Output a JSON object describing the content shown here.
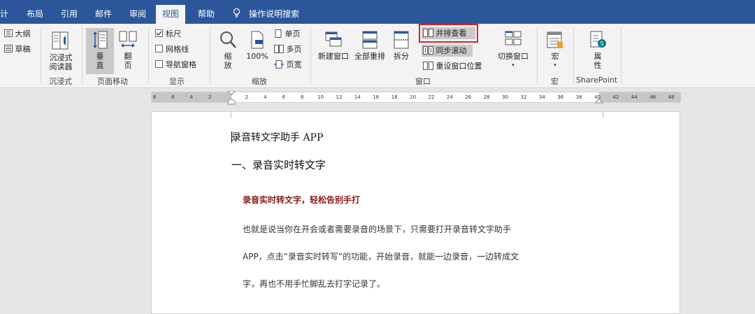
{
  "tabs": [
    {
      "label": "计",
      "active": false
    },
    {
      "label": "布局",
      "active": false
    },
    {
      "label": "引用",
      "active": false
    },
    {
      "label": "邮件",
      "active": false
    },
    {
      "label": "审阅",
      "active": false
    },
    {
      "label": "视图",
      "active": true
    },
    {
      "label": "帮助",
      "active": false
    }
  ],
  "tell_me": "操作说明搜索",
  "ribbon": {
    "views": {
      "outline": "大纲",
      "draft": "草稿"
    },
    "immersive": {
      "reader_line1": "沉浸式",
      "reader_line2": "阅读器",
      "group": "沉浸式"
    },
    "page_move": {
      "vertical_line1": "垂",
      "vertical_line2": "直",
      "flip_line1": "翻",
      "flip_line2": "页",
      "group": "页面移动"
    },
    "show": {
      "ruler": "标尺",
      "gridlines": "网格线",
      "nav_pane": "导航窗格",
      "group": "显示",
      "ruler_checked": true
    },
    "zoom": {
      "zoom_line1": "缩",
      "zoom_line2": "放",
      "hundred": "100%",
      "one_page": "单页",
      "multi_page": "多页",
      "page_width": "页宽",
      "group": "缩放"
    },
    "window": {
      "new_window": "新建窗口",
      "arrange_all": "全部重排",
      "split": "拆分",
      "side_by_side": "并排查看",
      "sync_scroll": "同步滚动",
      "reset_position": "重设窗口位置",
      "switch_window": "切换窗口",
      "group": "窗口"
    },
    "macros": {
      "label": "宏",
      "group": "宏"
    },
    "sharepoint": {
      "props_line1": "属",
      "props_line2": "性",
      "group": "SharePoint"
    }
  },
  "ruler_ticks": [
    "8",
    "6",
    "4",
    "2",
    "",
    "2",
    "4",
    "6",
    "8",
    "10",
    "12",
    "14",
    "16",
    "18",
    "20",
    "22",
    "24",
    "26",
    "28",
    "30",
    "32",
    "34",
    "36",
    "38",
    "40",
    "42",
    "44",
    "46",
    "48"
  ],
  "document": {
    "title": "录音转文字助手 APP",
    "heading1": "一、录音实时转文字",
    "heading2": "录音实时转文字，轻松告别手打",
    "para_line1": "也就是说当你在开会或者需要录音的场景下，只需要打开录音转文字助手",
    "para_line2": "APP，点击“录音实时转写”的功能，开始录音，就能一边录音，一边转成文",
    "para_line3": "字，再也不用手忙脚乱去打字记录了。"
  },
  "colors": {
    "accent": "#2b579a",
    "heading2": "#8b1a1a",
    "highlight_box": "#e02020"
  }
}
